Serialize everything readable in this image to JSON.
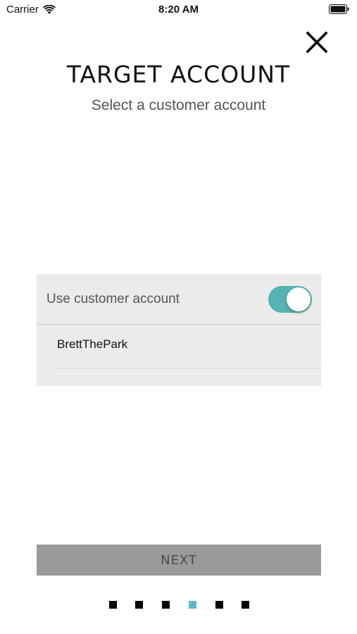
{
  "status_bar": {
    "carrier": "Carrier",
    "time": "8:20 AM",
    "wifi_icon": "wifi-icon",
    "battery_icon": "battery-icon"
  },
  "header": {
    "close_icon": "close-icon",
    "title": "TARGET ACCOUNT",
    "subtitle": "Select a customer account"
  },
  "account_panel": {
    "toggle_label": "Use customer account",
    "toggle_on": true,
    "toggle_color": "#54b3b3",
    "accounts": [
      {
        "name": "BrettThePark"
      }
    ]
  },
  "footer": {
    "next_label": "NEXT",
    "next_button_color": "#9a9a9a",
    "pages": 6,
    "current_page": 4,
    "active_dot_color": "#5bb8cc"
  }
}
